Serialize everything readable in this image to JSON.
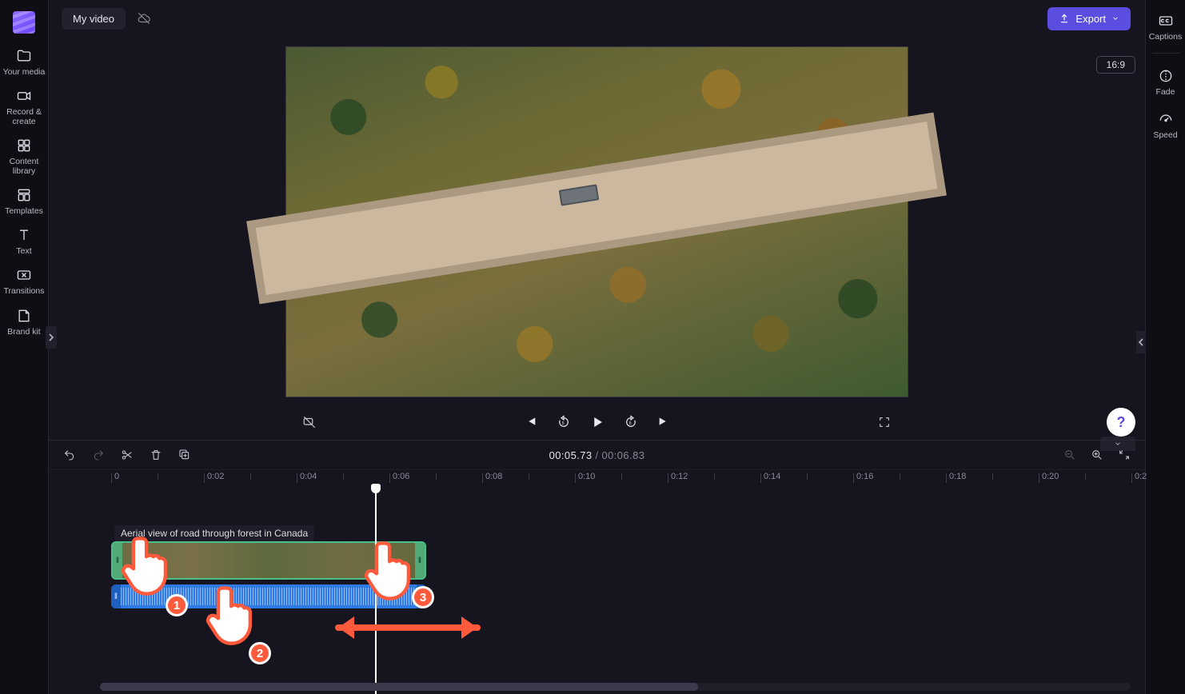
{
  "header": {
    "title": "My video",
    "export_label": "Export",
    "aspect_ratio": "16:9"
  },
  "left_sidebar": {
    "items": [
      {
        "label": "Your media"
      },
      {
        "label": "Record & create"
      },
      {
        "label": "Content library"
      },
      {
        "label": "Templates"
      },
      {
        "label": "Text"
      },
      {
        "label": "Transitions"
      },
      {
        "label": "Brand kit"
      }
    ]
  },
  "right_sidebar": {
    "items": [
      {
        "label": "Captions"
      },
      {
        "label": "Fade"
      },
      {
        "label": "Speed"
      }
    ]
  },
  "player": {
    "current_time": "00:05.73",
    "duration": "00:06.83"
  },
  "timeline": {
    "ruler_start": "0",
    "ticks": [
      "0:02",
      "0:04",
      "0:06",
      "0:08",
      "0:10",
      "0:12",
      "0:14",
      "0:16",
      "0:18",
      "0:20",
      "0:2"
    ],
    "clip_title": "Aerial view of road through forest in Canada"
  },
  "tutorial": {
    "step1": "1",
    "step2": "2",
    "step3": "3"
  }
}
